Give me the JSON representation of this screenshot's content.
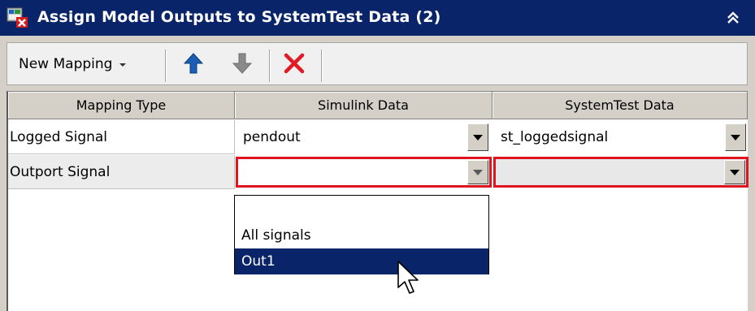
{
  "window": {
    "title": "Assign Model Outputs to SystemTest Data (2)",
    "icons": {
      "app": "matlab-app-icon",
      "collapse": "double-chevron-up-icon"
    }
  },
  "toolbar": {
    "new_mapping_label": "New Mapping",
    "new_mapping_icon": "small-triangle-down-icon",
    "move_up_icon": "arrow-up-icon",
    "move_down_icon": "arrow-down-icon",
    "delete_icon": "red-x-icon",
    "colors": {
      "move_up": "#1a5fb4",
      "move_down_disabled": "#8a8a8a",
      "delete": "#e01b24"
    }
  },
  "grid": {
    "columns": [
      "Mapping Type",
      "Simulink Data",
      "SystemTest Data"
    ],
    "rows": [
      {
        "mapping_type": "Logged Signal",
        "simulink_data": "pendout",
        "systemtest_data": "st_loggedsignal"
      },
      {
        "mapping_type": "Outport Signal",
        "simulink_data": "",
        "systemtest_data": ""
      }
    ],
    "error_color": "#e0141e"
  },
  "dropdown": {
    "options": [
      "",
      "All signals",
      "Out1"
    ],
    "highlighted": "Out1"
  }
}
